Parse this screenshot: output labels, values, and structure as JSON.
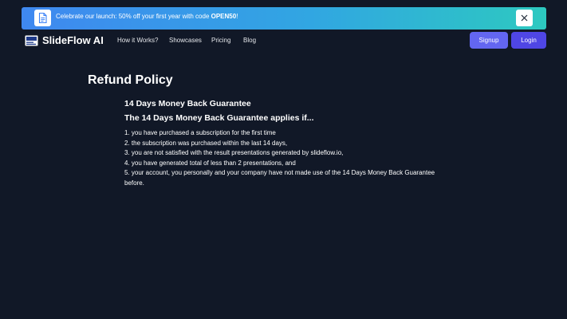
{
  "banner": {
    "text": "Celebrate our launch: 50% off your first year with code ",
    "code": "OPEN50",
    "suffix": "!",
    "icon": "document-icon",
    "close_icon": "close-icon"
  },
  "nav": {
    "brand": "SlideFlow AI",
    "links": [
      "How it Works?",
      "Showcases",
      "Pricing",
      "Blog"
    ],
    "signup_label": "Signup",
    "login_label": "Login"
  },
  "content": {
    "title": "Refund Policy",
    "guarantee_heading": "14 Days Money Back Guarantee",
    "applies_heading": "The 14 Days Money Back Guarantee applies if...",
    "conditions": [
      "1. you have purchased a subscription for the first time",
      "2. the subscription was purchased within the last 14 days,",
      "3. you are not satisfied with the result presentations generated by slideflow.io,",
      "4. you have generated total of less than 2 presentations, and",
      "5. your account, you personally and your company have not made use of the 14 Days Money Back Guarantee before."
    ]
  },
  "colors": {
    "background": "#111827",
    "banner_start": "#3f88f0",
    "banner_end": "#2dc9c0",
    "signup": "#6366f1",
    "login": "#4f46e5"
  }
}
